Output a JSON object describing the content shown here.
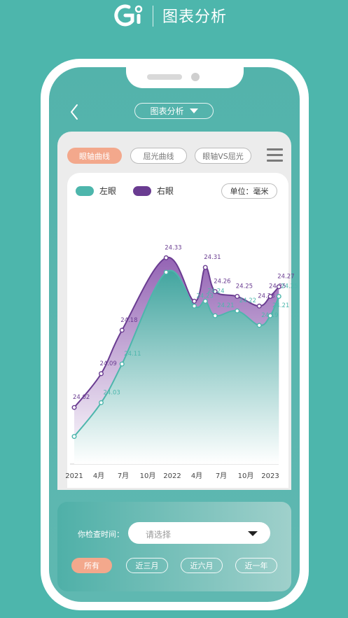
{
  "brand": {
    "title": "图表分析",
    "logo_icon": "g-logo-icon"
  },
  "header": {
    "dropdown_label": "图表分析"
  },
  "tabs": [
    {
      "label": "眼轴曲线",
      "active": true
    },
    {
      "label": "屈光曲线",
      "active": false
    },
    {
      "label": "眼轴VS屈光",
      "active": false
    }
  ],
  "legend": {
    "left_label": "左眼",
    "right_label": "右眼",
    "unit": "单位：毫米"
  },
  "colors": {
    "teal": "#4db6ac",
    "left_eye": "#4db6ac",
    "right_eye": "#6a3c91",
    "accent": "#f3a88c"
  },
  "chart_data": {
    "type": "area",
    "categories": [
      "2021",
      "4月",
      "7月",
      "10月",
      "2022",
      "4月",
      "7月",
      "10月",
      "2023"
    ],
    "series": [
      {
        "name": "右眼",
        "values": [
          24.02,
          24.09,
          24.18,
          24.33,
          24.24,
          24.31,
          24.26,
          24.25,
          24.23,
          24.25,
          24.27
        ],
        "labels": [
          "24.02",
          "24.09",
          "24.18",
          "24.33",
          "",
          "24.31",
          "24.26",
          "24.25",
          "24.23",
          "24.25",
          "24.27"
        ]
      },
      {
        "name": "左眼",
        "values": [
          23.96,
          24.03,
          24.11,
          24.3,
          24.23,
          24.24,
          24.21,
          24.22,
          24.19,
          24.21,
          24.25
        ],
        "labels": [
          "",
          "24.03",
          "24.11",
          "",
          "24.23",
          "24.24",
          "24.21",
          "24.22",
          "24.19",
          "24.21",
          "24.25"
        ]
      }
    ],
    "x_positions": [
      0,
      1.1,
      1.95,
      3.75,
      4.9,
      5.35,
      5.75,
      6.65,
      7.55,
      8.0,
      8.35
    ],
    "ylim": [
      23.9,
      24.4
    ]
  },
  "filter": {
    "label": "你检查时间：",
    "placeholder": "请选择",
    "chips": [
      "所有",
      "近三月",
      "近六月",
      "近一年"
    ]
  }
}
